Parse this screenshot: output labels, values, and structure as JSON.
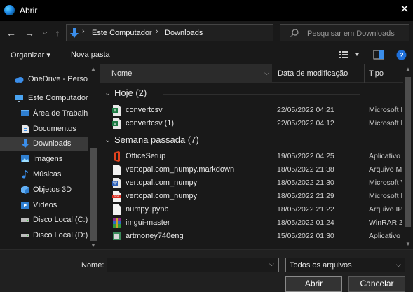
{
  "window": {
    "title": "Abrir",
    "close_glyph": "✕",
    "app_icon": "edge-browser-icon"
  },
  "nav": {
    "back_glyph": "←",
    "forward_glyph": "→",
    "dropdown_glyph": "⌵",
    "up_glyph": "↑",
    "address_segments": [
      "Este Computador",
      "Downloads"
    ],
    "address_sep": "›",
    "refresh_glyph": "↻",
    "search_placeholder": "Pesquisar em Downloads"
  },
  "toolbar": {
    "organize_label": "Organizar ▾",
    "new_folder_label": "Nova pasta"
  },
  "sidebar": {
    "items": [
      {
        "label": "OneDrive - Persor",
        "icon": "cloud-icon"
      },
      {
        "label": "Este Computador",
        "icon": "computer-icon"
      },
      {
        "label": "Área de Trabalhc",
        "icon": "desktop-icon"
      },
      {
        "label": "Documentos",
        "icon": "document-icon"
      },
      {
        "label": "Downloads",
        "icon": "download-icon",
        "selected": true
      },
      {
        "label": "Imagens",
        "icon": "pictures-icon"
      },
      {
        "label": "Músicas",
        "icon": "music-icon"
      },
      {
        "label": "Objetos 3D",
        "icon": "3d-objects-icon"
      },
      {
        "label": "Vídeos",
        "icon": "videos-icon"
      },
      {
        "label": "Disco Local (C:)",
        "icon": "drive-icon"
      },
      {
        "label": "Disco Local (D:)",
        "icon": "drive-icon"
      }
    ]
  },
  "columns": {
    "name": "Nome",
    "date": "Data de modificação",
    "type": "Tipo"
  },
  "groups": [
    {
      "label": "Hoje (2)",
      "files": [
        {
          "name": "convertcsv",
          "date": "22/05/2022 04:21",
          "type": "Microsoft E",
          "icon": "excel-csv-icon"
        },
        {
          "name": "convertcsv (1)",
          "date": "22/05/2022 04:12",
          "type": "Microsoft E",
          "icon": "excel-csv-icon"
        }
      ]
    },
    {
      "label": "Semana passada (7)",
      "files": [
        {
          "name": "OfficeSetup",
          "date": "19/05/2022 04:25",
          "type": "Aplicativo",
          "icon": "office-setup-icon"
        },
        {
          "name": "vertopal.com_numpy.markdown",
          "date": "18/05/2022 21:38",
          "type": "Arquivo MA",
          "icon": "blank-file-icon"
        },
        {
          "name": "vertopal.com_numpy",
          "date": "18/05/2022 21:30",
          "type": "Microsoft V",
          "icon": "word-doc-icon"
        },
        {
          "name": "vertopal.com_numpy",
          "date": "18/05/2022 21:29",
          "type": "Microsoft E",
          "icon": "pdf-icon"
        },
        {
          "name": "numpy.ipynb",
          "date": "18/05/2022 21:22",
          "type": "Arquivo IPY",
          "icon": "blank-file-icon"
        },
        {
          "name": "imgui-master",
          "date": "18/05/2022 01:24",
          "type": "WinRAR ZIP",
          "icon": "winrar-icon"
        },
        {
          "name": "artmoney740eng",
          "date": "15/05/2022 01:30",
          "type": "Aplicativo",
          "icon": "installer-icon"
        }
      ]
    }
  ],
  "footer": {
    "filename_label": "Nome:",
    "filename_value": "",
    "filter_value": "Todos os arquivos",
    "open_label": "Abrir",
    "cancel_label": "Cancelar"
  }
}
